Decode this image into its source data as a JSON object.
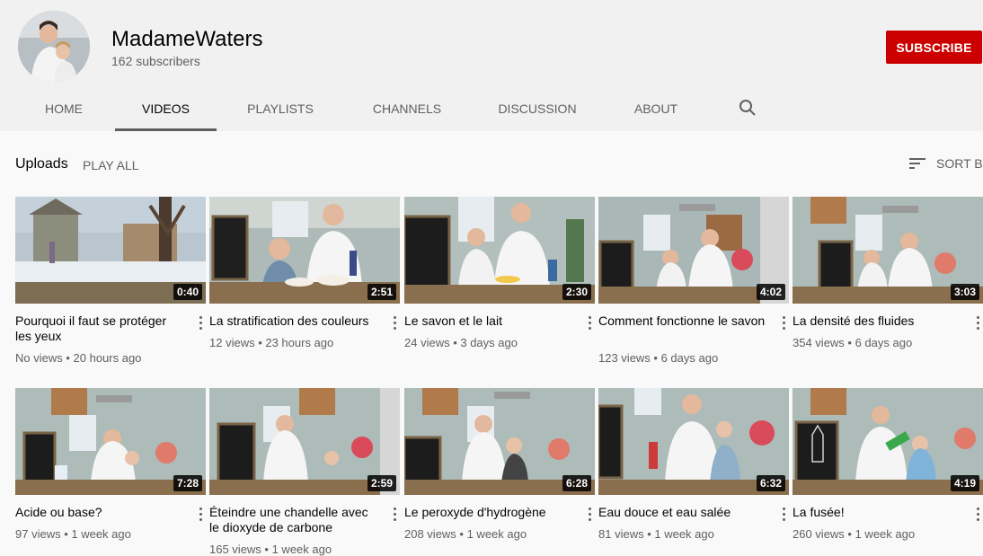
{
  "channel": {
    "name": "MadameWaters",
    "subscribers": "162 subscribers",
    "subscribe_label": "SUBSCRIBE"
  },
  "tabs": [
    {
      "label": "HOME"
    },
    {
      "label": "VIDEOS"
    },
    {
      "label": "PLAYLISTS"
    },
    {
      "label": "CHANNELS"
    },
    {
      "label": "DISCUSSION"
    },
    {
      "label": "ABOUT"
    }
  ],
  "active_tab": "VIDEOS",
  "uploads": {
    "label": "Uploads",
    "play_all": "PLAY ALL",
    "sort_label": "SORT BY"
  },
  "videos": [
    {
      "title": "Pourquoi il faut se protéger les yeux",
      "meta": "No views • 20 hours ago",
      "duration": "0:40"
    },
    {
      "title": "La stratification des couleurs",
      "meta": "12 views • 23 hours ago",
      "duration": "2:51"
    },
    {
      "title": "Le savon et le lait",
      "meta": "24 views • 3 days ago",
      "duration": "2:30"
    },
    {
      "title": "Comment fonctionne le savon",
      "meta": "123 views • 6 days ago",
      "duration": "4:02"
    },
    {
      "title": "La densité des fluides",
      "meta": "354 views • 6 days ago",
      "duration": "3:03"
    },
    {
      "title": "Acide ou base?",
      "meta": "97 views • 1 week ago",
      "duration": "7:28"
    },
    {
      "title": "Éteindre une chandelle avec le dioxyde de carbone",
      "meta": "165 views • 1 week ago",
      "duration": "2:59"
    },
    {
      "title": "Le peroxyde d'hydrogène",
      "meta": "208 views • 1 week ago",
      "duration": "6:28"
    },
    {
      "title": "Eau douce et eau salée",
      "meta": "81 views • 1 week ago",
      "duration": "6:32"
    },
    {
      "title": "La fusée!",
      "meta": "260 views • 1 week ago",
      "duration": "4:19"
    }
  ],
  "colors": {
    "subscribe_bg": "#cc0000",
    "header_bg": "#f1f1f1",
    "page_bg": "#f9f9f9"
  }
}
